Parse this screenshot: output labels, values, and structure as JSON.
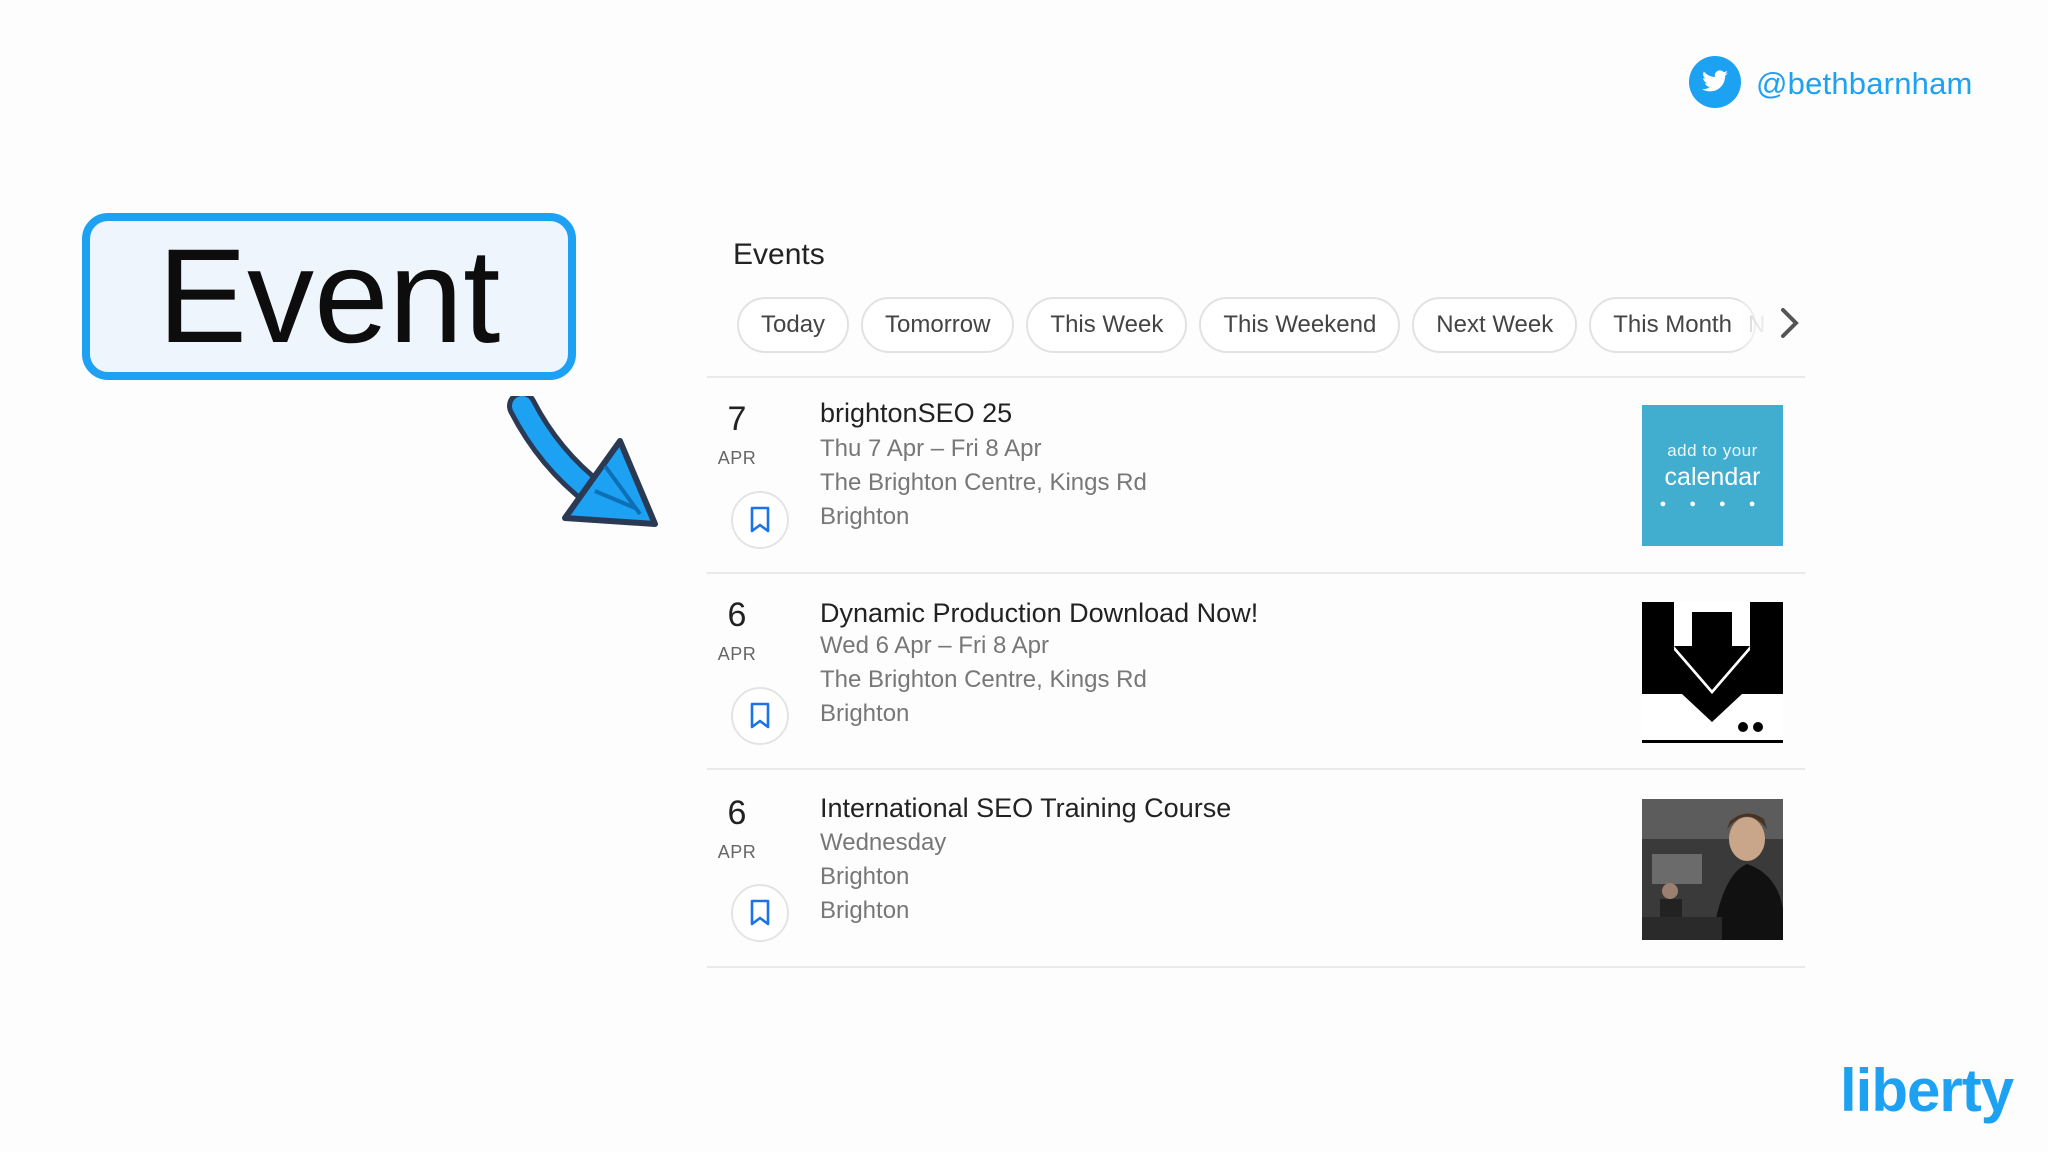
{
  "twitter": {
    "handle": "@bethbarnham",
    "icon": "twitter-bird-icon"
  },
  "callout": {
    "label": "Event",
    "arrow_icon": "arrow-down-right-icon"
  },
  "events_panel": {
    "title": "Events",
    "chips": [
      "Today",
      "Tomorrow",
      "This Week",
      "This Weekend",
      "Next Week",
      "This Month"
    ],
    "chip_partial": "N",
    "next_icon": "chevron-right-icon",
    "events": [
      {
        "day": "7",
        "month": "APR",
        "title": "brightonSEO 25",
        "dates": "Thu 7 Apr – Fri 8 Apr",
        "venue": "The Brighton Centre, Kings Rd",
        "city": "Brighton",
        "bookmark_icon": "bookmark-icon",
        "thumb": {
          "small": "add to your",
          "big": "calendar",
          "icons": "● ● ● ●"
        }
      },
      {
        "day": "6",
        "month": "APR",
        "title": "Dynamic Production Download Now!",
        "dates": "Wed 6 Apr – Fri 8 Apr",
        "venue": "The Brighton Centre, Kings Rd",
        "city": "Brighton",
        "bookmark_icon": "bookmark-icon",
        "thumb_icon": "download-arrow-icon"
      },
      {
        "day": "6",
        "month": "APR",
        "title": "International SEO Training Course",
        "dates": "Wednesday",
        "venue": "Brighton",
        "city": "Brighton",
        "bookmark_icon": "bookmark-icon",
        "thumb_icon": "photo-thumbnail"
      }
    ]
  },
  "brand": {
    "logo": "liberty",
    "accent": "#1da1f2"
  }
}
